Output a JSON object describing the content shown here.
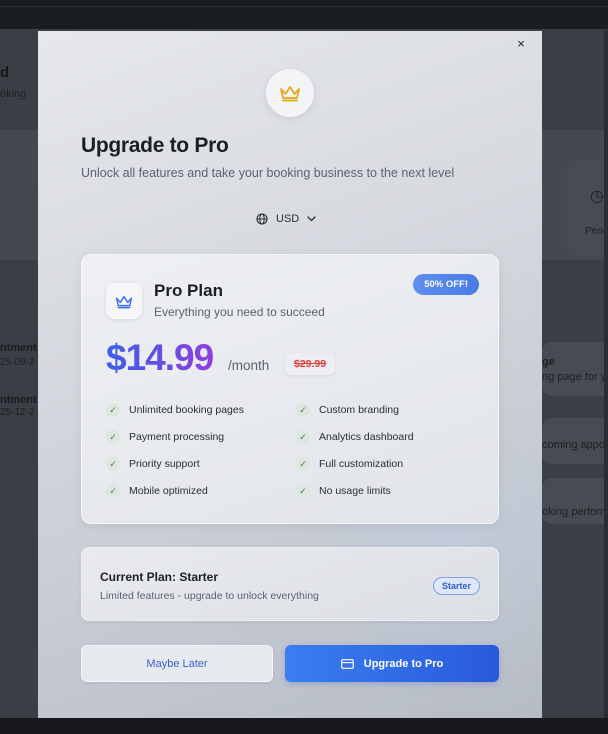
{
  "background": {
    "heading_fragment": "d",
    "subtext_fragment": "oking",
    "row1_title": "ntment f",
    "row1_date": "25-09-2",
    "row2_title": "ntment f",
    "row2_date": "25-12-2",
    "right_label1": "ge",
    "right_label1_sub": "ng page for y",
    "right_label2": "coming appo",
    "right_label3": "oking perform",
    "pending_fragment": "Penc"
  },
  "modal": {
    "close_label": "×",
    "title": "Upgrade to Pro",
    "subtitle": "Unlock all features and take your booking business to the next level",
    "currency": "USD",
    "icons": {
      "header": "crown-icon",
      "currency": "globe-icon",
      "plan": "crown-icon",
      "upgrade": "credit-card-icon"
    },
    "colors": {
      "accent": "#3a6ee8",
      "price_gradient_start": "#3d5ee8",
      "price_gradient_end": "#8e3fe0",
      "crown": "#e6a81e",
      "strike_red": "#e03a3a"
    }
  },
  "plan": {
    "badge": "50% OFF!",
    "name": "Pro Plan",
    "tagline": "Everything you need to succeed",
    "price": "$14.99",
    "period": "/month",
    "old_price": "$29.99",
    "features_left": [
      "Unlimited booking pages",
      "Payment processing",
      "Priority support",
      "Mobile optimized"
    ],
    "features_right": [
      "Custom branding",
      "Analytics dashboard",
      "Full customization",
      "No usage limits"
    ]
  },
  "current_plan": {
    "title": "Current Plan: Starter",
    "description": "Limited features - upgrade to unlock everything",
    "badge": "Starter"
  },
  "actions": {
    "later_label": "Maybe Later",
    "upgrade_label": "Upgrade to Pro"
  }
}
